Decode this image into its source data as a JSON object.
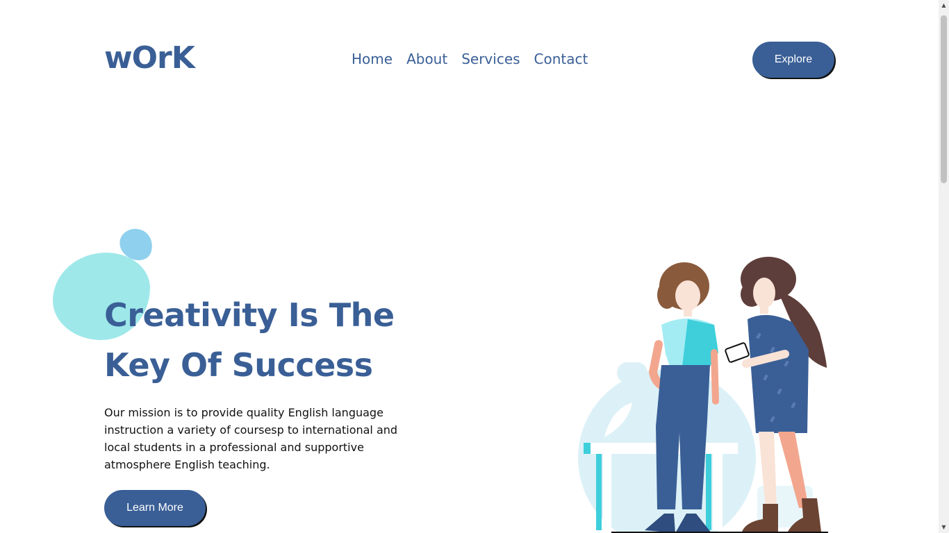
{
  "header": {
    "logo": "wOrK",
    "nav": [
      {
        "label": "Home"
      },
      {
        "label": "About"
      },
      {
        "label": "Services"
      },
      {
        "label": "Contact"
      }
    ],
    "cta_label": "Explore"
  },
  "hero": {
    "title_line1": "Creativity Is The",
    "title_line2": "Key Of Success",
    "description": "Our mission is to provide quality English language instruction a variety of coursesp to international and local students in a professional and supportive atmosphere English teaching.",
    "button_label": "Learn More"
  },
  "colors": {
    "brand": "#3a5f96",
    "accent_teal": "#9ee8ea",
    "accent_blue": "#8fd0ee"
  },
  "icons": {
    "scroll_up": "scroll-up-arrow-icon",
    "scroll_down": "scroll-down-arrow-icon"
  }
}
